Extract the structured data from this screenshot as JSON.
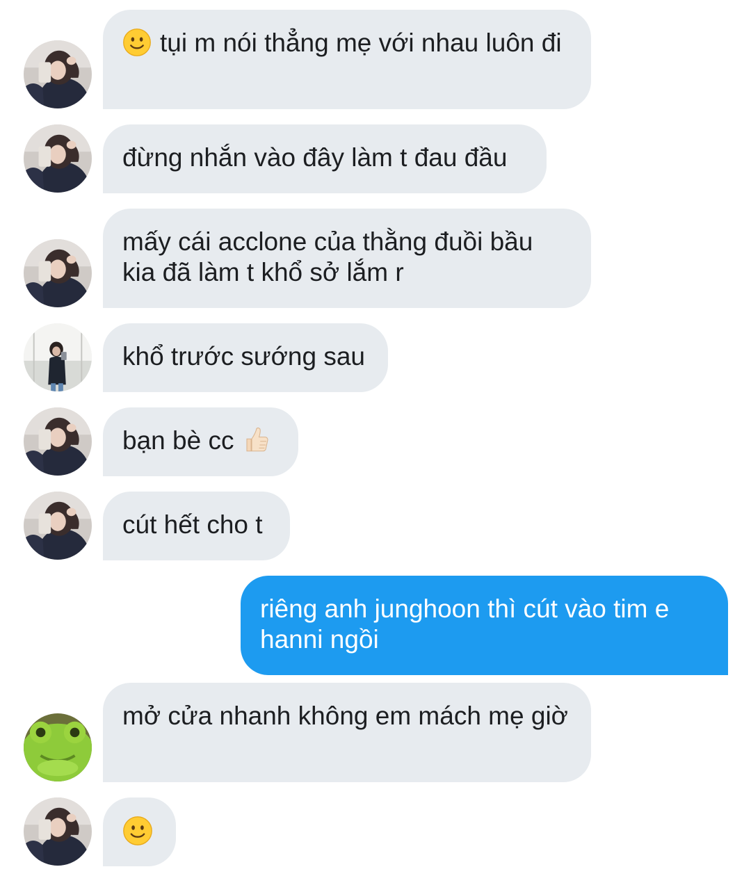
{
  "messages": [
    {
      "sender": "girl",
      "direction": "in",
      "emoji_before": "slightly-smiling-face",
      "text": "tụi m nói thẳng mẹ với nhau luôn đi"
    },
    {
      "sender": "girl",
      "direction": "in",
      "text": "đừng nhắn vào đây làm t đau đầu"
    },
    {
      "sender": "girl",
      "direction": "in",
      "text": "mấy cái acclone của thằng đuồi bầu kia đã làm t khổ sở lắm r"
    },
    {
      "sender": "mirror",
      "direction": "in",
      "text": "khổ trước sướng sau"
    },
    {
      "sender": "girl",
      "direction": "in",
      "text": "bạn bè cc",
      "emoji_after": "thumbs-up"
    },
    {
      "sender": "girl",
      "direction": "in",
      "text": "cút hết cho t"
    },
    {
      "sender": "me",
      "direction": "out",
      "text": "riêng anh junghoon thì cút vào tim e hanni ngồi"
    },
    {
      "sender": "frog",
      "direction": "in",
      "text": "mở cửa nhanh không em mách mẹ giờ"
    },
    {
      "sender": "girl",
      "direction": "in",
      "emoji_only": "slightly-smiling-face"
    }
  ],
  "colors": {
    "incoming_bubble": "#e7ebef",
    "outgoing_bubble": "#1d9bf0",
    "incoming_text": "#1c1e21",
    "outgoing_text": "#ffffff"
  }
}
